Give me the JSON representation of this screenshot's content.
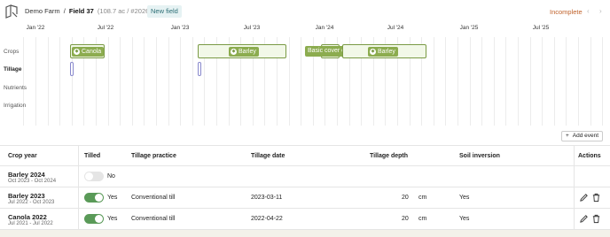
{
  "header": {
    "logo_icon": "field-map-icon",
    "farm_name": "Demo Farm",
    "separator": "/",
    "field_name": "Field 37",
    "field_meta": "(108.7 ac / #202615)",
    "new_field_label": "New field",
    "status": "Incomplete",
    "prev_icon": "chevron-left-icon",
    "next_icon": "chevron-right-icon"
  },
  "timeline": {
    "axis_labels": [
      "Jan '22",
      "Jul '22",
      "Jan '23",
      "Jul '23",
      "Jan '24",
      "Jul '24",
      "Jan '25",
      "Jul '25"
    ],
    "rows": [
      "Crops",
      "Tillage",
      "Nutrients",
      "Irrigation"
    ],
    "crops": [
      {
        "label": "Canola",
        "icon": "seedling-icon"
      },
      {
        "label": "Barley",
        "icon": "seedling-icon"
      },
      {
        "label": "Basic cover crop",
        "icon": ""
      },
      {
        "label": "Barley",
        "icon": "seedling-icon"
      }
    ]
  },
  "add_event_label": "Add event",
  "table": {
    "headers": {
      "crop_year": "Crop year",
      "tilled": "Tilled",
      "practice": "Tillage practice",
      "date": "Tillage date",
      "depth": "Tillage depth",
      "inversion": "Soil inversion",
      "actions": "Actions"
    },
    "rows": [
      {
        "title": "Barley 2024",
        "range": "Oct 2023 - Oct 2024",
        "tilled": "No",
        "tilled_on": false,
        "practice": "",
        "date": "",
        "depth": "",
        "unit": "",
        "inversion": "",
        "actions": false
      },
      {
        "title": "Barley 2023",
        "range": "Jul 2022 - Oct 2023",
        "tilled": "Yes",
        "tilled_on": true,
        "practice": "Conventional till",
        "date": "2023-03-11",
        "depth": "20",
        "unit": "cm",
        "inversion": "Yes",
        "actions": true
      },
      {
        "title": "Canola 2022",
        "range": "Jul 2021 - Jul 2022",
        "tilled": "Yes",
        "tilled_on": true,
        "practice": "Conventional till",
        "date": "2022-04-22",
        "depth": "20",
        "unit": "cm",
        "inversion": "Yes",
        "actions": true
      }
    ]
  },
  "colors": {
    "accent_green": "#8cac4f",
    "status_orange": "#c0622b",
    "toggle_on": "#5a9a58"
  }
}
